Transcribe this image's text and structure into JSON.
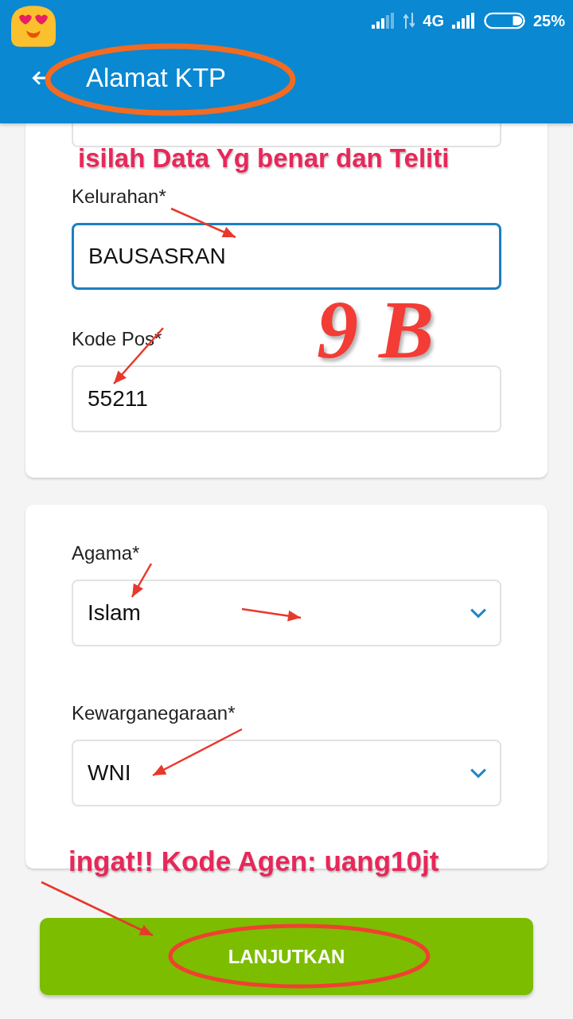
{
  "status_bar": {
    "network": "4G",
    "battery": "25%"
  },
  "app_bar": {
    "title": "Alamat KTP"
  },
  "cards": [
    {
      "fields": [
        {
          "kind": "cut_text",
          "focused": false
        },
        {
          "kind": "text",
          "label": "Kelurahan*",
          "value": "BAUSASRAN",
          "focused": true
        },
        {
          "kind": "text",
          "label": "Kode Pos*",
          "value": "55211",
          "focused": false
        }
      ]
    },
    {
      "fields": [
        {
          "kind": "select",
          "label": "Agama*",
          "value": "Islam",
          "focused": false
        },
        {
          "kind": "select",
          "label": "Kewarganegaraan*",
          "value": "WNI",
          "focused": false
        }
      ]
    }
  ],
  "button": {
    "label": "LANJUTKAN"
  },
  "annotations": {
    "top_note": "isilah Data Yg benar dan Teliti",
    "big_mark": "9 B",
    "bottom_note": "ingat!! Kode Agen: uang10jt"
  }
}
